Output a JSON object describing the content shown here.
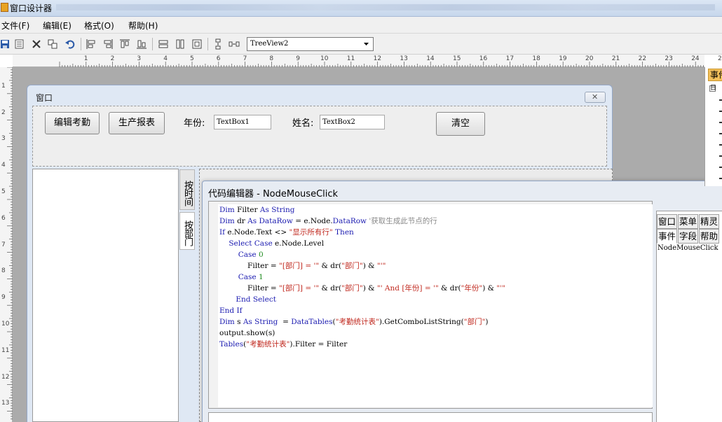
{
  "window": {
    "title": "窗口设计器"
  },
  "menu": [
    "文件(F)",
    "编辑(E)",
    "格式(O)",
    "帮助(H)"
  ],
  "toolbar": {
    "icons": [
      "save-icon",
      "list-icon",
      "delete-icon",
      "copy-icon",
      "undo-icon",
      "align-left-icon",
      "align-right-icon",
      "align-top-icon",
      "align-bottom-icon",
      "same-width-icon",
      "same-height-icon",
      "same-size-icon",
      "vertical-spacing-icon",
      "horizontal-spacing-icon"
    ],
    "combo_value": "TreeView2"
  },
  "ruler": {
    "h": [
      "1",
      "2",
      "3",
      "4",
      "5",
      "6",
      "7",
      "8",
      "9",
      "10",
      "11",
      "12",
      "13",
      "14",
      "15",
      "16",
      "17",
      "18",
      "19",
      "20",
      "21",
      "22",
      "23",
      "24",
      "25"
    ],
    "v": [
      "1",
      "2",
      "3",
      "4",
      "5",
      "6",
      "7",
      "8",
      "9",
      "10",
      "11",
      "12",
      "13"
    ]
  },
  "form": {
    "title": "窗口",
    "buttons": {
      "edit_attendance": "编辑考勤",
      "production_report": "生产报表",
      "clear": "清空"
    },
    "labels": {
      "year": "年份:",
      "name": "姓名:"
    },
    "textboxes": {
      "year": "TextBox1",
      "name": "TextBox2"
    },
    "tabs": {
      "by_time": "按时间",
      "by_dept": "按部门"
    }
  },
  "editor": {
    "title": "代码编辑器 - NodeMouseClick",
    "code_lines": [
      [
        [
          "kw",
          "Dim"
        ],
        [
          "tx",
          " Filter "
        ],
        [
          "kw",
          "As"
        ],
        [
          "kw",
          " String"
        ]
      ],
      [
        [
          "kw",
          "Dim"
        ],
        [
          "tx",
          " dr "
        ],
        [
          "kw",
          "As"
        ],
        [
          "kw",
          " DataRow"
        ],
        [
          "tx",
          " = e.Node."
        ],
        [
          "kw",
          "DataRow"
        ],
        [
          "cm",
          " '获取生成此节点的行"
        ]
      ],
      [
        [
          "kw",
          "If"
        ],
        [
          "tx",
          " e.Node.Text <> "
        ],
        [
          "st",
          "\"显示所有行\""
        ],
        [
          "kw",
          " Then"
        ]
      ],
      [
        [
          "tx",
          "    "
        ],
        [
          "kw",
          "Select Case"
        ],
        [
          "tx",
          " e.Node.Level"
        ]
      ],
      [
        [
          "tx",
          "        "
        ],
        [
          "kw",
          "Case"
        ],
        [
          "nm",
          " 0"
        ]
      ],
      [
        [
          "tx",
          "            Filter = "
        ],
        [
          "st",
          "\"[部门] = '\""
        ],
        [
          "tx",
          " & dr("
        ],
        [
          "st",
          "\"部门\""
        ],
        [
          "tx",
          ") & "
        ],
        [
          "st",
          "\"'\""
        ]
      ],
      [
        [
          "tx",
          "        "
        ],
        [
          "kw",
          "Case"
        ],
        [
          "nm",
          " 1"
        ]
      ],
      [
        [
          "tx",
          "            Filter = "
        ],
        [
          "st",
          "\"[部门] = '\""
        ],
        [
          "tx",
          " & dr("
        ],
        [
          "st",
          "\"部门\""
        ],
        [
          "tx",
          ") & "
        ],
        [
          "st",
          "\"' And [年份] = '\""
        ],
        [
          "tx",
          " & dr("
        ],
        [
          "st",
          "\"年份\""
        ],
        [
          "tx",
          ") & "
        ],
        [
          "st",
          "\"'\""
        ]
      ],
      [
        [
          "tx",
          "       "
        ],
        [
          "kw",
          "End Select"
        ]
      ],
      [
        [
          "kw",
          "End If"
        ]
      ],
      [
        [
          "kw",
          "Dim"
        ],
        [
          "tx",
          " s "
        ],
        [
          "kw",
          "As"
        ],
        [
          "kw",
          " String"
        ],
        [
          "tx",
          "  = "
        ],
        [
          "kw",
          "DataTables"
        ],
        [
          "tx",
          "("
        ],
        [
          "st",
          "\"考勤统计表\""
        ],
        [
          "tx",
          ").GetComboListString("
        ],
        [
          "st",
          "\"部门\""
        ],
        [
          "tx",
          ")"
        ]
      ],
      [
        [
          "tx",
          "output.show(s)"
        ]
      ],
      [
        [
          "kw",
          "Tables"
        ],
        [
          "tx",
          "("
        ],
        [
          "st",
          "\"考勤统计表\""
        ],
        [
          "tx",
          ").Filter = Filter"
        ]
      ]
    ],
    "side_tabs_row1": [
      "窗口",
      "菜单",
      "精灵"
    ],
    "side_tabs_row2": [
      "事件",
      "字段",
      "帮助"
    ],
    "side_list": [
      "NodeMouseClick"
    ]
  },
  "properties": {
    "tab": "事件",
    "tree_toggle": "日"
  }
}
